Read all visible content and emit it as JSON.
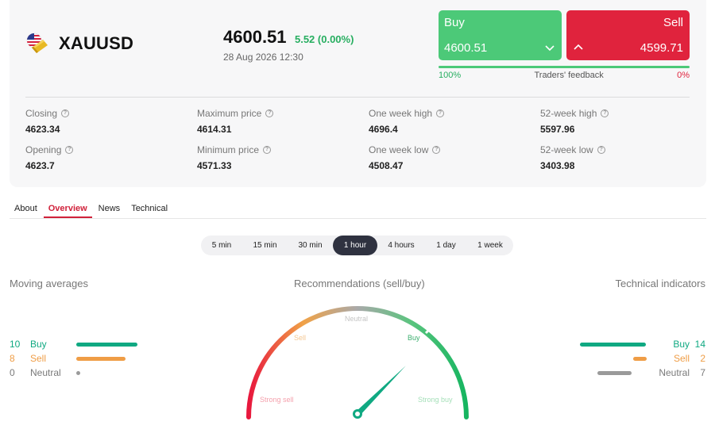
{
  "symbol": {
    "name": "XAUUSD",
    "icon": "us-flag-gold-bar-icon"
  },
  "quote": {
    "price": "4600.51",
    "change": "5.52 (0.00%)",
    "date": "28 Aug 2026 12:30"
  },
  "trade": {
    "buy_label": "Buy",
    "buy_price": "4600.51",
    "sell_label": "Sell",
    "sell_price": "4599.71"
  },
  "feedback": {
    "buy_pct": "100%",
    "label": "Traders' feedback",
    "sell_pct": "0%",
    "buy_fraction": 1.0
  },
  "stats": [
    {
      "label": "Closing",
      "value": "4623.34"
    },
    {
      "label": "Maximum price",
      "value": "4614.31"
    },
    {
      "label": "One week high",
      "value": "4696.4"
    },
    {
      "label": "52-week high",
      "value": "5597.96"
    },
    {
      "label": "Opening",
      "value": "4623.7"
    },
    {
      "label": "Minimum price",
      "value": "4571.33"
    },
    {
      "label": "One week low",
      "value": "4508.47"
    },
    {
      "label": "52-week low",
      "value": "3403.98"
    }
  ],
  "tabs": [
    "About",
    "Overview",
    "News",
    "Technical"
  ],
  "active_tab": "Overview",
  "periods": [
    "5 min",
    "15 min",
    "30 min",
    "1 hour",
    "4 hours",
    "1 day",
    "1 week"
  ],
  "active_period": "1 hour",
  "moving_averages": {
    "title": "Moving averages",
    "buy": {
      "count": "10",
      "label": "Buy"
    },
    "sell": {
      "count": "8",
      "label": "Sell"
    },
    "neutral": {
      "count": "0",
      "label": "Neutral"
    }
  },
  "recommendations": {
    "title": "Recommendations (sell/buy)",
    "labels": {
      "strong_sell": "Strong sell",
      "sell": "Sell",
      "neutral": "Neutral",
      "buy": "Buy",
      "strong_buy": "Strong buy"
    },
    "needle_value": 0.75
  },
  "technical_indicators": {
    "title": "Technical indicators",
    "buy": {
      "count": "14",
      "label": "Buy"
    },
    "sell": {
      "count": "2",
      "label": "Sell"
    },
    "neutral": {
      "count": "7",
      "label": "Neutral"
    }
  },
  "colors": {
    "buy": "#4cc978",
    "sell": "#e0233d",
    "accent": "#d0213a",
    "active_period": "#2f3240"
  }
}
